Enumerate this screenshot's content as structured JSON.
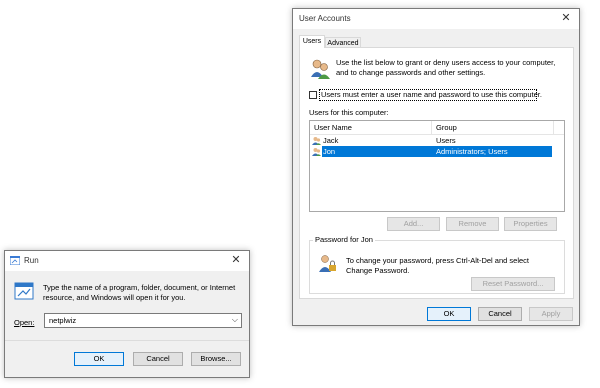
{
  "user_accounts": {
    "title": "User Accounts",
    "tabs": [
      "Users",
      "Advanced"
    ],
    "intro_text": "Use the list below to grant or deny users access to your computer, and to change passwords and other settings.",
    "checkbox_label": "Users must enter a user name and password to use this computer.",
    "checkbox_checked": false,
    "users_label": "Users for this computer:",
    "columns": [
      "User Name",
      "Group"
    ],
    "rows": [
      {
        "name": "Jack",
        "group": "Users",
        "selected": false
      },
      {
        "name": "Jon",
        "group": "Administrators; Users",
        "selected": true
      }
    ],
    "add_button": "Add...",
    "remove_button": "Remove",
    "properties_button": "Properties",
    "password_group_label": "Password for Jon",
    "password_text": "To change your password, press Ctrl-Alt-Del and select Change Password.",
    "reset_button": "Reset Password...",
    "ok_button": "OK",
    "cancel_button": "Cancel",
    "apply_button": "Apply",
    "selection_color": "#0078d7"
  },
  "run_dialog": {
    "title": "Run",
    "description": "Type the name of a program, folder, document, or Internet resource, and Windows will open it for you.",
    "open_label": "Open:",
    "open_value": "netplwiz",
    "ok_button": "OK",
    "cancel_button": "Cancel",
    "browse_button": "Browse..."
  }
}
